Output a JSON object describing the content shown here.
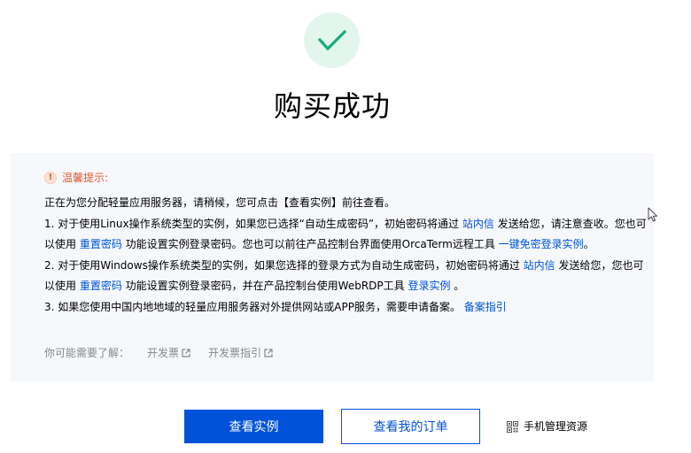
{
  "page": {
    "title": "购买成功"
  },
  "notice": {
    "title": "温馨提示:",
    "intro": "正在为您分配轻量应用服务器，请稍候，您可点击【查看实例】前往查看。",
    "item1": {
      "part1": "1. 对于使用Linux操作系统类型的实例，如果您已选择“自动生成密码”，初始密码将通过 ",
      "link1": "站内信",
      "part2": " 发送给您，请注意查收。您也可以使用 ",
      "link2": "重置密码",
      "part3": " 功能设置实例登录密码。您也可以前往产品控制台界面使用OrcaTerm远程工具 ",
      "link3": "一键免密登录实例",
      "part4": "。"
    },
    "item2": {
      "part1": "2. 对于使用Windows操作系统类型的实例，如果您选择的登录方式为自动生成密码，初始密码将通过 ",
      "link1": "站内信",
      "part2": " 发送给您，您也可以使用 ",
      "link2": "重置密码",
      "part3": " 功能设置实例登录密码，并在产品控制台使用WebRDP工具 ",
      "link3": "登录实例",
      "part4": " 。"
    },
    "item3": {
      "part1": "3. 如果您使用中国内地地域的轻量应用服务器对外提供网站或APP服务，需要申请备案。 ",
      "link1": "备案指引"
    }
  },
  "also": {
    "label": "你可能需要了解：",
    "links": [
      {
        "label": "开发票"
      },
      {
        "label": "开发票指引"
      }
    ]
  },
  "actions": {
    "view_instance": "查看实例",
    "view_orders": "查看我的订单",
    "mobile_manage": "手机管理资源"
  },
  "icons": {
    "success": "check-icon",
    "warning": "exclamation-icon",
    "external": "external-link-icon",
    "qr": "qr-code-icon",
    "cursor": "mouse-cursor-icon"
  },
  "colors": {
    "primary": "#0052d9",
    "success": "#1aab7d",
    "success_bg": "#e3f6ee",
    "warning": "#e4572e",
    "panel_bg": "#f6f8fb",
    "muted": "#888888"
  }
}
